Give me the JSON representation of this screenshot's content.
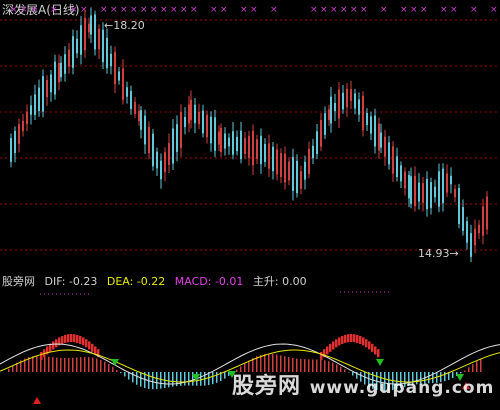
{
  "window": {
    "title": "深发展A(日线)"
  },
  "price_panel": {
    "high_label": "18.20",
    "low_label": "14.93",
    "high_value": 18.2,
    "low_value": 14.93,
    "arrow_symbol": "←",
    "arrow_symbol_right": "→"
  },
  "indicator_panel": {
    "name": "股旁网",
    "dif": "DIF: -0.23",
    "dea": "DEA: -0.22",
    "macd": "MACD: -0.01",
    "zs": "主升: 0.00"
  },
  "watermark": {
    "text": "股旁网",
    "site": "www.gupang.com"
  },
  "colors": {
    "up": "#d04040",
    "down": "#60c8d8",
    "grid": "#a00000",
    "marker": "#d040d0",
    "dea_line": "#e8e800",
    "dif_line": "#e0e0e0",
    "buy": "#e02020",
    "sell": "#20c020"
  }
}
